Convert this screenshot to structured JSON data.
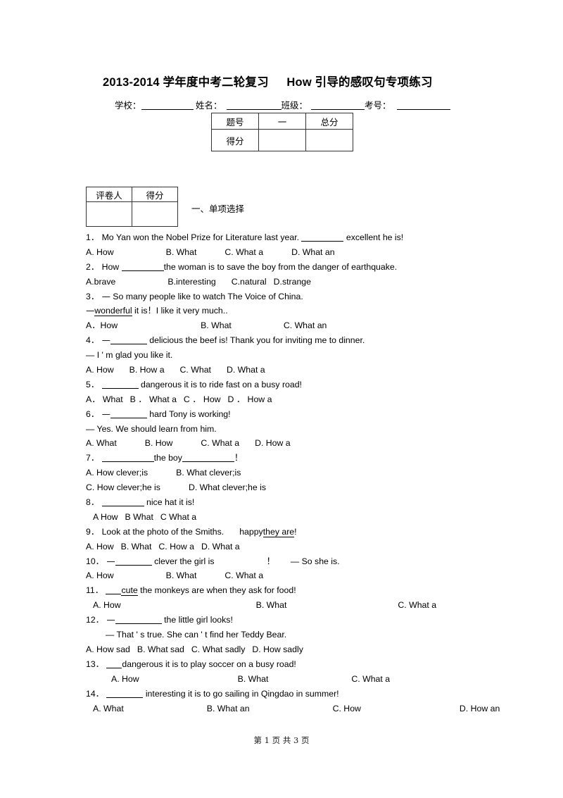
{
  "document": {
    "title_year": "2013-2014",
    "title_cn_part1": "学年度中考二轮复习",
    "title_en": "How",
    "title_cn_part2": "引导的感叹句专项练习",
    "footer": "第 1 页  共 3 页"
  },
  "identity": {
    "school_label": "学校：",
    "name_label": "姓名：",
    "class_label": "班级：",
    "exam_no_label": "考号："
  },
  "score_table": {
    "headers": [
      "题号",
      "一",
      "总分"
    ],
    "rows": [
      {
        "label": "得分",
        "cells": [
          "",
          ""
        ]
      }
    ]
  },
  "grader_table": {
    "headers": [
      "评卷人",
      "得分"
    ],
    "rows": [
      {
        "cells": [
          "",
          ""
        ]
      }
    ]
  },
  "section": {
    "heading": "一、单项选择"
  },
  "questions": {
    "q1": {
      "num": "1．",
      "stem_before": "Mo Yan won the Nobel Prize for Literature last year.",
      "stem_after": "excellent he is!",
      "options": [
        "A. How",
        "B. What",
        "C. What a",
        "D. What an"
      ]
    },
    "q2": {
      "num": "2．",
      "stem_before": "How",
      "stem_after": "the woman is to save the boy from the danger of earthquake.",
      "options": [
        "A.brave",
        "B.interesting",
        "C.natural",
        "D.strange"
      ]
    },
    "q3": {
      "num": "3．",
      "dash": "—",
      "stem_line1": "So many people like to watch The Voice of China.",
      "reply_dash": "—",
      "reply_underlined": "wonderful",
      "reply_rest": "it is！I like it very much..",
      "options": [
        "A．How",
        "B. What",
        "C. What an"
      ]
    },
    "q4": {
      "num": "4．",
      "dash": "—",
      "stem_after": "delicious the beef is! Thank you for inviting me to dinner.",
      "reply": "— I ' m glad you like it.",
      "options": [
        "A. How",
        "B. How a",
        "C. What",
        "D. What a"
      ]
    },
    "q5": {
      "num": "5．",
      "stem_after": "dangerous it is to ride fast on a busy road!",
      "options": [
        "A． What",
        "B ． What a",
        "C ． How",
        "D ． How a"
      ]
    },
    "q6": {
      "num": "6．",
      "dash": "—",
      "stem_after": "hard Tony is working!",
      "reply": "— Yes. We should learn from him.",
      "options": [
        "A. What",
        "B. How",
        "C. What a",
        "D. How a"
      ]
    },
    "q7": {
      "num": "7．",
      "stem_middle": "the boy",
      "stem_end": "！",
      "options": [
        "A. How clever;is",
        "B. What clever;is",
        "C. How clever;he is",
        "D. What clever;he is"
      ]
    },
    "q8": {
      "num": "8．",
      "stem_after": "nice hat it is!",
      "options": [
        "A How",
        "B What",
        "C What a"
      ]
    },
    "q9": {
      "num": "9．",
      "stem_before": "Look at the photo of the Smiths.",
      "stem_mid": "happy",
      "stem_underlined": "they are",
      "stem_end": "!",
      "options": [
        "A. How",
        "B. What",
        "C. How a",
        "D. What a"
      ]
    },
    "q10": {
      "num": "10．",
      "dash": "—",
      "stem_after": "clever the girl is",
      "stem_mark": "！",
      "reply": "— So she is.",
      "options": [
        "A. How",
        "B. What",
        "C. What a"
      ]
    },
    "q11": {
      "num": "11．",
      "stem_underlined": "cute",
      "stem_after": "the monkeys are when they ask for food!",
      "options": [
        "A. How",
        "B. What",
        "C. What a"
      ]
    },
    "q12": {
      "num": "12．",
      "dash": "—",
      "stem_after": "the little girl looks!",
      "reply": "— That ' s true. She can ' t find her Teddy Bear.",
      "options": [
        "A. How sad",
        "B. What sad",
        "C. What sadly",
        "D. How sadly"
      ]
    },
    "q13": {
      "num": "13．",
      "stem_after": "dangerous it is to play soccer on a busy road!",
      "options": [
        "A. How",
        "B. What",
        "C. What a"
      ]
    },
    "q14": {
      "num": "14．",
      "stem_after": "interesting it is to go sailing in Qingdao in summer!",
      "options": [
        "A. What",
        "B. What an",
        "C. How",
        "D. How an"
      ]
    }
  }
}
